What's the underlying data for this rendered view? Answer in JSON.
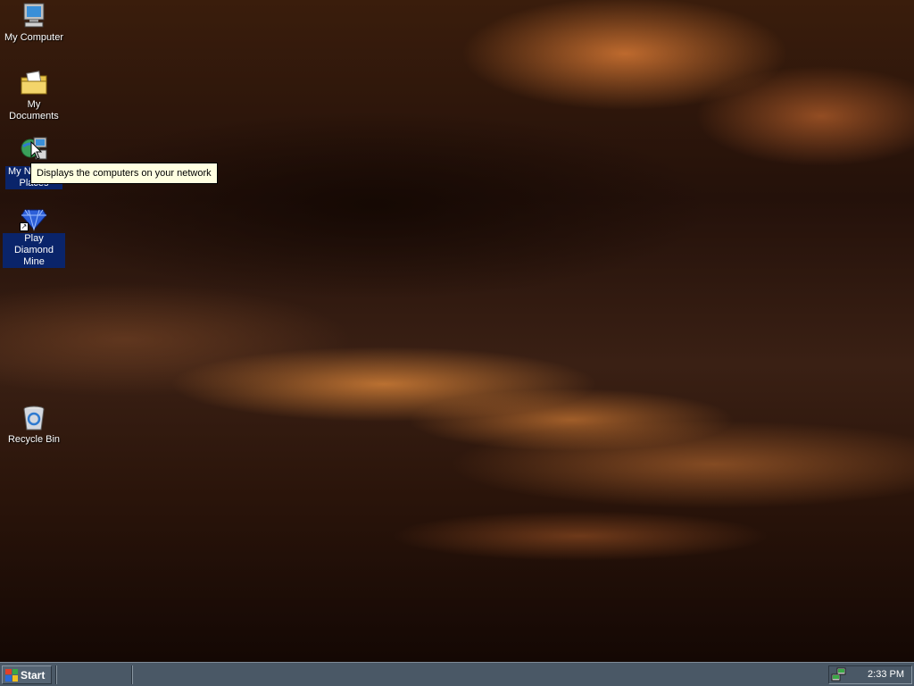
{
  "desktop": {
    "icons": [
      {
        "label": "My Computer",
        "icon": "computer-icon"
      },
      {
        "label": "My Documents",
        "icon": "documents-folder-icon"
      },
      {
        "label": "My Network Places",
        "icon": "network-icon"
      },
      {
        "label": "Play Diamond Mine",
        "icon": "diamond-icon"
      },
      {
        "label": "Recycle Bin",
        "icon": "recycle-bin-icon"
      }
    ],
    "tooltip": "Displays the computers on your network"
  },
  "taskbar": {
    "start_label": "Start",
    "clock": "2:33 PM",
    "tray_icon": "network-tray-icon"
  }
}
